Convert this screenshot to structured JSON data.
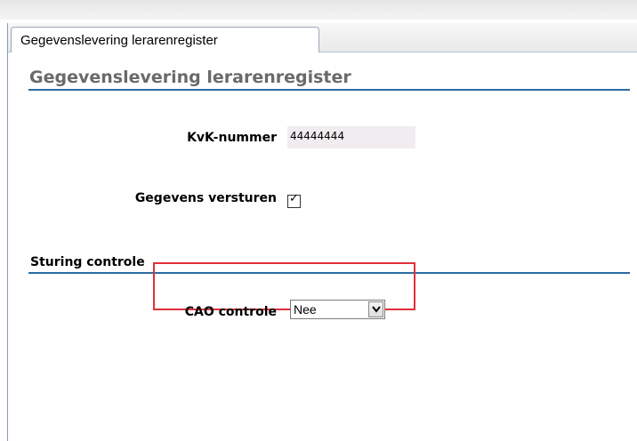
{
  "tab": {
    "label": "Gegevenslevering lerarenregister"
  },
  "page": {
    "title": "Gegevenslevering lerarenregister"
  },
  "form": {
    "kvk_label": "KvK-nummer",
    "kvk_value": "44444444",
    "send_label": "Gegevens versturen",
    "send_checked": true
  },
  "control_section": {
    "title": "Sturing controle",
    "cao_label": "CAO controle",
    "cao_selected": "Nee"
  },
  "icons": {
    "checkmark": "check-icon",
    "dropdown": "chevron-down-icon"
  },
  "colors": {
    "accent_rule": "#2a6aa3",
    "highlight_border": "#e0303a"
  }
}
